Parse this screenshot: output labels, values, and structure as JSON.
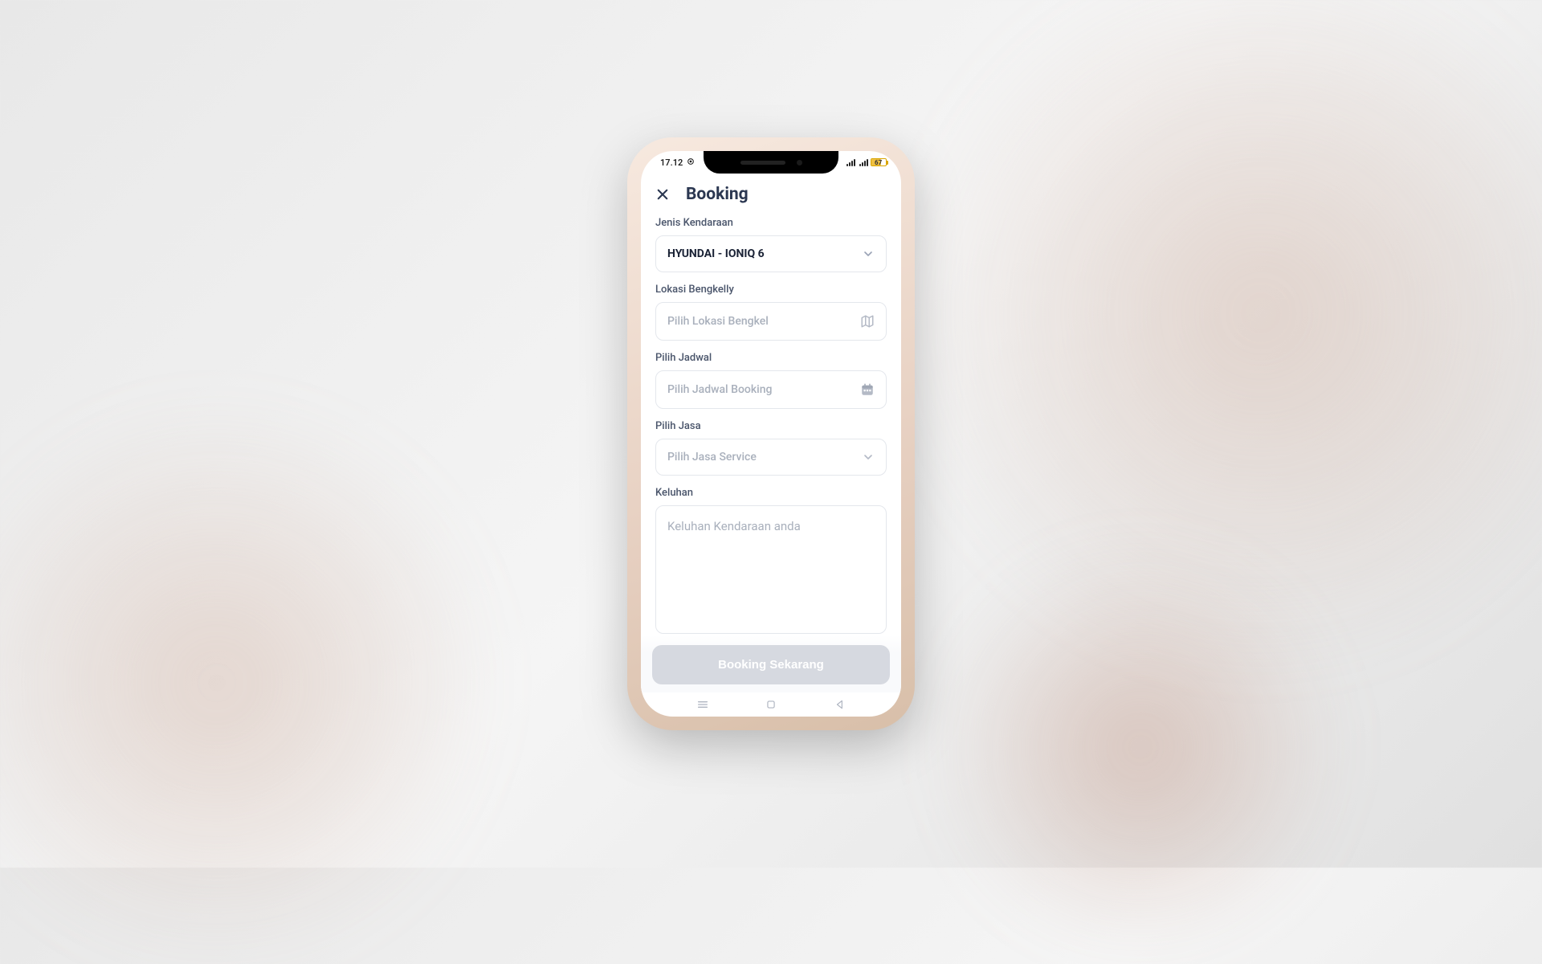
{
  "status": {
    "time": "17.12",
    "battery_pct": "67"
  },
  "header": {
    "title": "Booking"
  },
  "fields": {
    "vehicle": {
      "label": "Jenis Kendaraan",
      "value": "HYUNDAI - IONIQ 6"
    },
    "location": {
      "label": "Lokasi Bengkelly",
      "placeholder": "Pilih Lokasi Bengkel"
    },
    "schedule": {
      "label": "Pilih Jadwal",
      "placeholder": "Pilih Jadwal Booking"
    },
    "service": {
      "label": "Pilih Jasa",
      "placeholder": "Pilih Jasa Service"
    },
    "complaint": {
      "label": "Keluhan",
      "placeholder": "Keluhan Kendaraan anda"
    }
  },
  "submit_label": "Booking Sekarang"
}
